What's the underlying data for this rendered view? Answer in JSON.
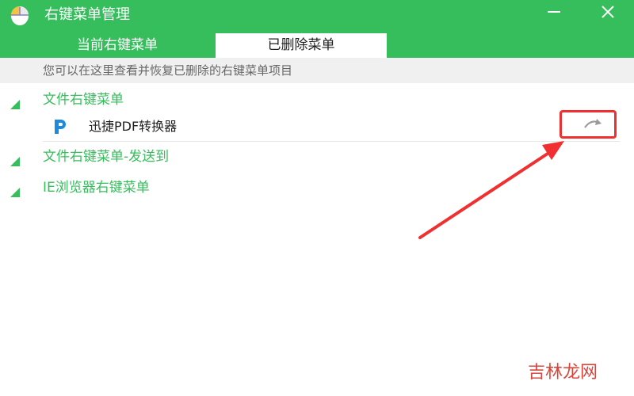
{
  "window": {
    "title": "右键菜单管理",
    "icons": {
      "app": "mouse-icon",
      "minimize": "minimize-icon",
      "close": "close-icon"
    }
  },
  "tabs": [
    {
      "label": "当前右键菜单",
      "active": false
    },
    {
      "label": "已删除菜单",
      "active": true
    }
  ],
  "hint": "您可以在这里查看并恢复已删除的右键菜单项目",
  "groups": [
    {
      "label": "文件右键菜单",
      "expanded": true,
      "items": [
        {
          "label": "迅捷PDF转换器",
          "icon": "pdf-converter-icon",
          "action_icon": "restore-icon"
        }
      ]
    },
    {
      "label": "文件右键菜单-发送到",
      "expanded": true,
      "items": []
    },
    {
      "label": "IE浏览器右键菜单",
      "expanded": true,
      "items": []
    }
  ],
  "annotation": {
    "color": "#f03030"
  },
  "watermark": "吉林龙网",
  "colors": {
    "accent": "#36be5c",
    "hint_bg": "#f0f0f0",
    "annotation": "#f03030"
  }
}
